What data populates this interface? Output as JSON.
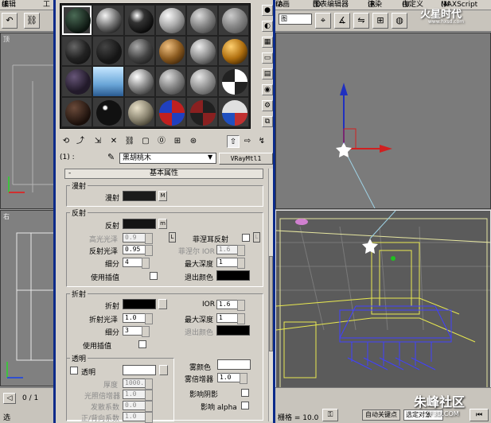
{
  "menubar": {
    "items": [
      "编辑",
      "工",
      "动画",
      "图表编辑器",
      "渲染",
      "自定义",
      "MAXScript"
    ],
    "item_shortcuts": [
      "E",
      "",
      "A",
      "D",
      "R",
      "U",
      "M"
    ]
  },
  "toolbar": {
    "view_select": "图"
  },
  "watermark_top": {
    "title": "火星时代",
    "sub": "www.hxsd.com"
  },
  "watermark_bottom": {
    "title": "朱峰社区",
    "sub": "ZF3D.COM"
  },
  "viewports": {
    "top_left_label": "顶",
    "bottom_left_label": "右"
  },
  "bottom_bar": {
    "frame_counter": "0 / 1",
    "grid_label": "栅格 = 10.0",
    "auto_key": "自动关键点",
    "filter_select": "选定对象",
    "left_label": "选"
  },
  "material": {
    "id_label": "(1) :",
    "name": "黑胡桃木",
    "type": "VRayMtl1",
    "rollout_title": "基本属性",
    "rollout_minus": "-",
    "diffuse": {
      "group": "漫射",
      "label": "漫射",
      "map": "M",
      "color": "#1b1b1b"
    },
    "reflect": {
      "group": "反射",
      "reflect_label": "反射",
      "reflect_map": "m",
      "reflect_color": "#141414",
      "hilight_gloss_label": "高光光泽",
      "hilight_gloss_value": "0.9",
      "lock_label": "L",
      "fresnel_label": "菲涅耳反射",
      "fresnel_lock": "L",
      "refl_gloss_label": "反射光泽",
      "refl_gloss_value": "0.95",
      "fresnel_ior_label": "菲涅尔 IOR",
      "fresnel_ior_value": "1.6",
      "subdivs_label": "细分",
      "subdivs_value": "4",
      "max_depth_label": "最大深度",
      "max_depth_value": "1",
      "interp_label": "使用插值",
      "exit_color_label": "退出颜色",
      "exit_color": "#000000"
    },
    "refract": {
      "group": "折射",
      "refract_label": "折射",
      "refract_color": "#000000",
      "ior_label": "IOR",
      "ior_value": "1.6",
      "gloss_label": "折射光泽",
      "gloss_value": "1.0",
      "max_depth_label": "最大深度",
      "max_depth_value": "1",
      "subdivs_label": "细分",
      "subdivs_value": "3",
      "exit_color_label": "退出颜色",
      "exit_color": "#000000",
      "interp_label": "使用插值"
    },
    "translucency": {
      "group": "透明",
      "check_label": "透明",
      "color": "#ffffff",
      "thickness_label": "厚度",
      "thickness_value": "1000.",
      "light_mult_label": "光照倍增器",
      "light_mult_value": "1.0",
      "scatter_label": "发散系数",
      "scatter_value": "0.0",
      "fwd_back_label": "正/背向系数",
      "fwd_back_value": "1.0"
    },
    "fog": {
      "color_label": "雾颜色",
      "color": "#ffffff",
      "mult_label": "雾倍增器",
      "mult_value": "1.0",
      "shadow_label": "影响阴影",
      "alpha_label": "影响 alpha"
    }
  }
}
